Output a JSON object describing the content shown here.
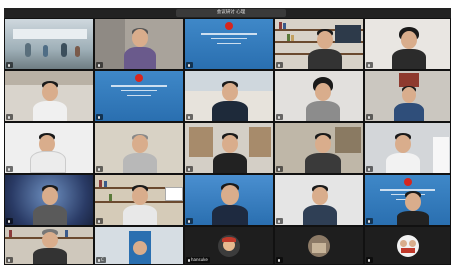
{
  "meeting": {
    "title": "会议研讨  心理"
  },
  "tiles": [
    {
      "name": ""
    },
    {
      "name": ""
    },
    {
      "name": ""
    },
    {
      "name": ""
    },
    {
      "name": ""
    },
    {
      "name": ""
    },
    {
      "name": ""
    },
    {
      "name": ""
    },
    {
      "name": ""
    },
    {
      "name": ""
    },
    {
      "name": ""
    },
    {
      "name": ""
    },
    {
      "name": ""
    },
    {
      "name": ""
    },
    {
      "name": ""
    },
    {
      "name": ""
    },
    {
      "name": ""
    },
    {
      "name": ""
    },
    {
      "name": ""
    },
    {
      "name": ""
    },
    {
      "name": ""
    },
    {
      "name": "C"
    },
    {
      "name": "hansuke"
    },
    {
      "name": ""
    },
    {
      "name": ""
    }
  ]
}
